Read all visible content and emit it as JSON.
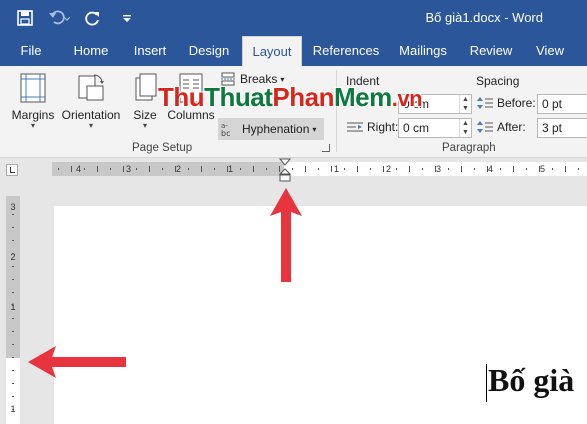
{
  "window": {
    "title": "Bố già1.docx  -  Word"
  },
  "tabs": [
    {
      "label": "File",
      "active": false
    },
    {
      "label": "Home",
      "active": false
    },
    {
      "label": "Insert",
      "active": false
    },
    {
      "label": "Design",
      "active": false
    },
    {
      "label": "Layout",
      "active": true
    },
    {
      "label": "References",
      "active": false
    },
    {
      "label": "Mailings",
      "active": false
    },
    {
      "label": "Review",
      "active": false
    },
    {
      "label": "View",
      "active": false
    }
  ],
  "ribbon": {
    "page_setup": {
      "margins": "Margins",
      "orientation": "Orientation",
      "size": "Size",
      "columns": "Columns",
      "breaks": "Breaks",
      "hyphenation": "Hyphenation",
      "group_label": "Page Setup"
    },
    "paragraph": {
      "indent_title": "Indent",
      "spacing_title": "Spacing",
      "left_value": "0 cm",
      "right_label": "Right:",
      "right_value": "0 cm",
      "before_label": "Before:",
      "before_value": "0 pt",
      "after_label": "After:",
      "after_value": "3 pt",
      "group_label": "Paragraph"
    }
  },
  "watermark": {
    "part1": "Thu",
    "part2": "Thuat",
    "part3": "Phan",
    "part4": "Mem",
    "part5": ".vn"
  },
  "ruler": {
    "h_numbers": [
      "4",
      "3",
      "2",
      "1",
      "1",
      "2",
      "3",
      "4",
      "5"
    ],
    "v_numbers": [
      "3",
      "2",
      "1",
      "1"
    ]
  },
  "document": {
    "text": "Bố già"
  },
  "colors": {
    "accent": "#2b579a",
    "arrow": "#e8343f"
  }
}
